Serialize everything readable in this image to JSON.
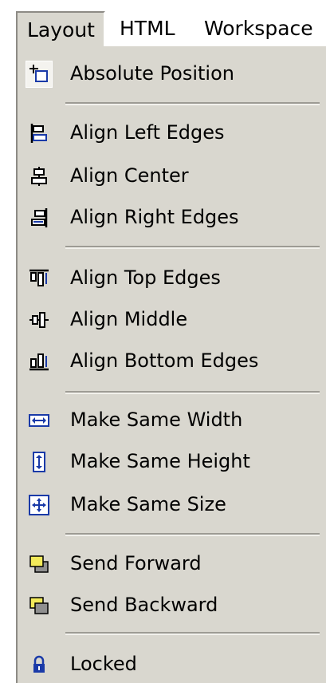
{
  "menubar": {
    "layout": "Layout",
    "html": "HTML",
    "workspace": "Workspace"
  },
  "menu": {
    "absolute_position": "Absolute Position",
    "align_left_edges": "Align Left Edges",
    "align_center": "Align Center",
    "align_right_edges": "Align Right Edges",
    "align_top_edges": "Align Top Edges",
    "align_middle": "Align Middle",
    "align_bottom_edges": "Align Bottom Edges",
    "make_same_width": "Make Same Width",
    "make_same_height": "Make Same Height",
    "make_same_size": "Make Same Size",
    "send_forward": "Send Forward",
    "send_backward": "Send Backward",
    "locked": "Locked"
  },
  "icons": {
    "absolute_position": "absolute-position-icon",
    "align_left_edges": "align-left-edges-icon",
    "align_center": "align-center-icon",
    "align_right_edges": "align-right-edges-icon",
    "align_top_edges": "align-top-edges-icon",
    "align_middle": "align-middle-icon",
    "align_bottom_edges": "align-bottom-edges-icon",
    "make_same_width": "make-same-width-icon",
    "make_same_height": "make-same-height-icon",
    "make_same_size": "make-same-size-icon",
    "send_forward": "send-forward-icon",
    "send_backward": "send-backward-icon",
    "locked": "lock-icon"
  },
  "colors": {
    "menu_background": "#d9d7cf",
    "icon_blue": "#1a3aa8",
    "icon_yellow": "#f2ea5a",
    "icon_gray": "#8f8f8f"
  }
}
